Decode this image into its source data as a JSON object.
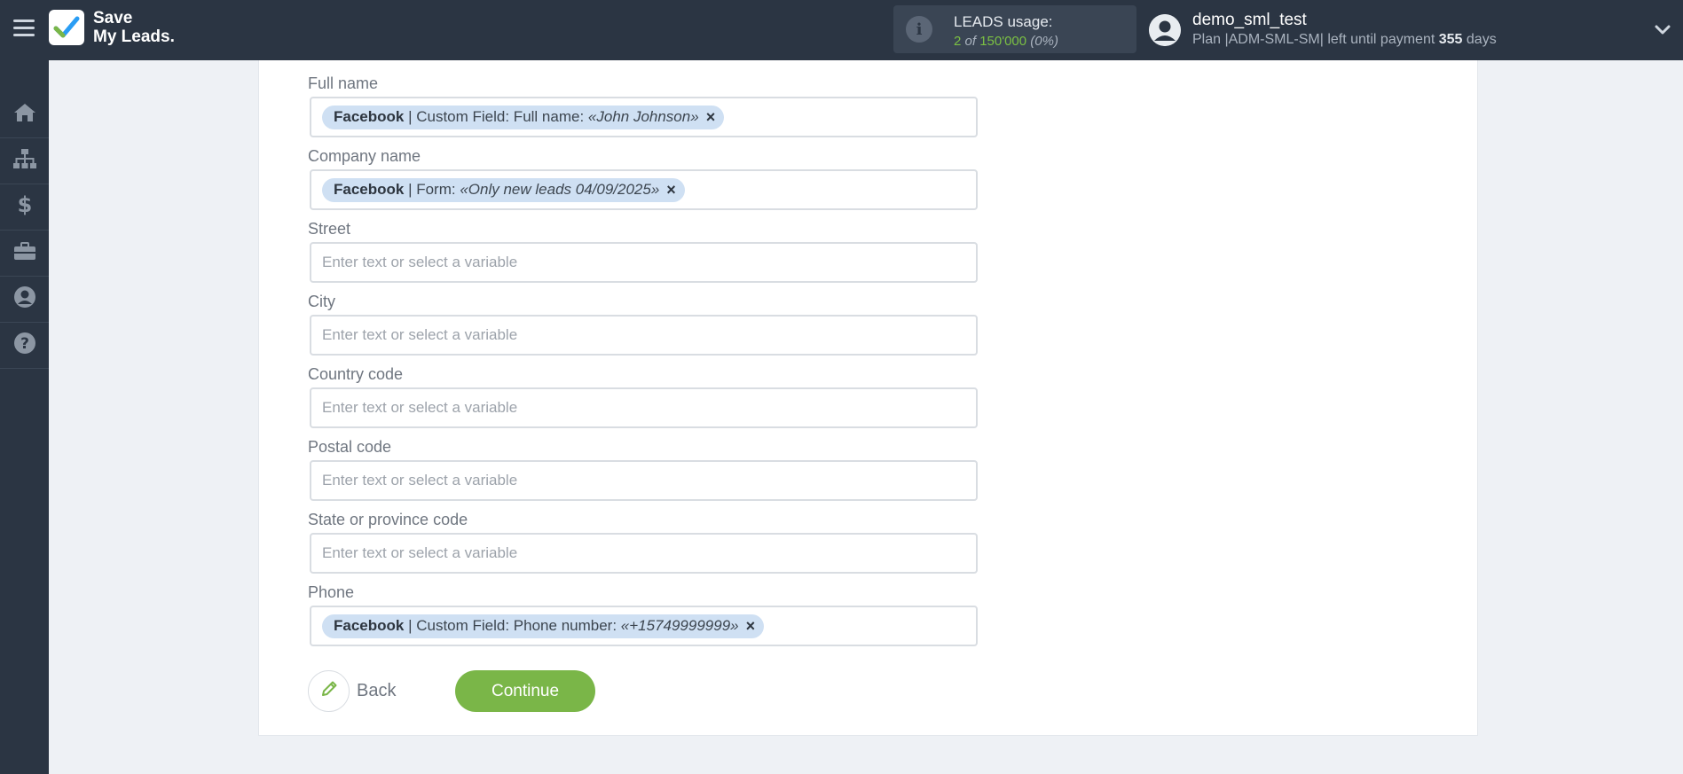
{
  "app": {
    "logo_line1": "Save",
    "logo_line2": "My Leads."
  },
  "usage": {
    "title": "LEADS usage:",
    "used": "2",
    "of_word": "of",
    "total": "150'000",
    "percent": "(0%)"
  },
  "user": {
    "name": "demo_sml_test",
    "plan_prefix": "Plan |ADM-SML-SM| left until payment",
    "days_count": "355",
    "days_word": "days"
  },
  "sidebar": {
    "items": [
      {
        "icon": "home-icon"
      },
      {
        "icon": "sitemap-icon"
      },
      {
        "icon": "dollar-icon"
      },
      {
        "icon": "briefcase-icon"
      },
      {
        "icon": "user-circle-icon"
      },
      {
        "icon": "help-icon"
      }
    ]
  },
  "form": {
    "placeholder": "Enter text or select a variable",
    "fields": [
      {
        "label": "Full name",
        "chip": {
          "source": "Facebook",
          "text": " | Custom Field: Full name: ",
          "value": "«John Johnson»"
        }
      },
      {
        "label": "Company name",
        "chip": {
          "source": "Facebook",
          "text": " | Form: ",
          "value": "«Only new leads 04/09/2025»"
        }
      },
      {
        "label": "Street"
      },
      {
        "label": "City"
      },
      {
        "label": "Country code"
      },
      {
        "label": "Postal code"
      },
      {
        "label": "State or province code"
      },
      {
        "label": "Phone",
        "chip": {
          "source": "Facebook",
          "text": " | Custom Field: Phone number: ",
          "value": "«+15749999999»"
        }
      }
    ],
    "remove_symbol": "×"
  },
  "actions": {
    "back_label": "Back",
    "continue_label": "Continue"
  },
  "colors": {
    "topbar": "#2b3543",
    "accent_green": "#7ab648",
    "chip_bg": "#cfe0f3"
  }
}
